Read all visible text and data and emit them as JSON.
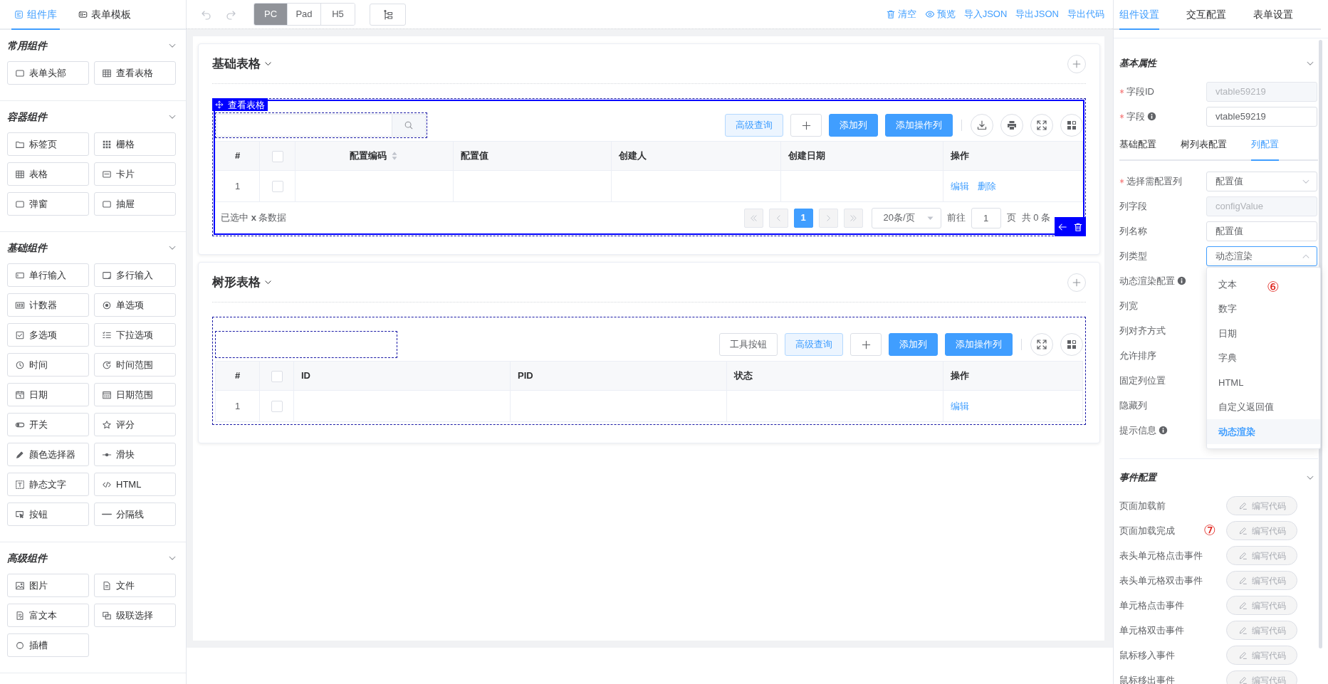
{
  "sidebar": {
    "tabs": [
      {
        "label": "组件库",
        "selected": true
      },
      {
        "label": "表单模板",
        "selected": false
      }
    ],
    "groups": [
      {
        "title": "常用组件",
        "expanded": true,
        "items": [
          "表单头部",
          "查看表格"
        ]
      },
      {
        "title": "容器组件",
        "expanded": true,
        "items": [
          "标签页",
          "栅格",
          "表格",
          "卡片",
          "弹窗",
          "抽屉"
        ]
      },
      {
        "title": "基础组件",
        "expanded": true,
        "items": [
          "单行输入",
          "多行输入",
          "计数器",
          "单选项",
          "多选项",
          "下拉选项",
          "时间",
          "时间范围",
          "日期",
          "日期范围",
          "开关",
          "评分",
          "颜色选择器",
          "滑块",
          "静态文字",
          "HTML",
          "按钮",
          "分隔线"
        ]
      },
      {
        "title": "高级组件",
        "expanded": true,
        "items": [
          "图片",
          "文件",
          "富文本",
          "级联选择",
          "插槽"
        ]
      }
    ]
  },
  "toolbar": {
    "devices": [
      {
        "label": "PC",
        "selected": true
      },
      {
        "label": "Pad",
        "selected": false
      },
      {
        "label": "H5",
        "selected": false
      }
    ],
    "actions": [
      "清空",
      "预览",
      "导入JSON",
      "导出JSON",
      "导出代码"
    ]
  },
  "canvas": {
    "panels": [
      {
        "title": "基础表格",
        "widget": {
          "tag": "查看表格",
          "selected": true,
          "search": {
            "kind": "button"
          },
          "buttons": [
            {
              "kind": "light",
              "label": "高级查询"
            },
            {
              "kind": "add"
            },
            {
              "kind": "primary",
              "label": "添加列"
            },
            {
              "kind": "primary",
              "label": "添加操作列"
            }
          ],
          "columns": [
            {
              "kind": "index",
              "label": "#"
            },
            {
              "kind": "checkbox",
              "checked": false
            },
            {
              "kind": "text",
              "label": "配置编码",
              "sortable": true
            },
            {
              "kind": "text",
              "label": "配置值",
              "sortable": false
            },
            {
              "kind": "text",
              "label": "创建人",
              "sortable": false
            },
            {
              "kind": "text",
              "label": "创建日期",
              "sortable": false
            },
            {
              "kind": "actions",
              "label": "操作"
            }
          ],
          "rows": [
            {
              "index": "1",
              "checked": false,
              "actions": [
                "编辑",
                "删除"
              ]
            }
          ],
          "footer": {
            "note": "已选中 **x** 条数据",
            "pages": [
              {
                "label": "1",
                "selected": true
              }
            ],
            "page_size": "20条/页",
            "goto_label": "前往",
            "goto_value": "1",
            "page_unit": "页",
            "total": "共 0 条"
          }
        }
      },
      {
        "title": "树形表格",
        "widget": {
          "selected": false,
          "search": {
            "kind": "plain"
          },
          "buttons": [
            {
              "kind": "outline",
              "label": "工具按钮"
            },
            {
              "kind": "light",
              "label": "高级查询"
            },
            {
              "kind": "add"
            },
            {
              "kind": "primary",
              "label": "添加列"
            },
            {
              "kind": "primary",
              "label": "添加操作列"
            }
          ],
          "columns": [
            {
              "kind": "index",
              "label": "#"
            },
            {
              "kind": "checkbox",
              "checked": false
            },
            {
              "kind": "text",
              "label": "ID",
              "sortable": false
            },
            {
              "kind": "text",
              "label": "PID",
              "sortable": false
            },
            {
              "kind": "text",
              "label": "状态",
              "sortable": false
            },
            {
              "kind": "actions",
              "label": "操作"
            }
          ],
          "rows": [
            {
              "index": "1",
              "checked": false,
              "actions": [
                "编辑"
              ]
            }
          ]
        }
      }
    ]
  },
  "properties": {
    "tabs": [
      {
        "label": "组件设置",
        "selected": true
      },
      {
        "label": "交互配置",
        "selected": false
      },
      {
        "label": "表单设置",
        "selected": false
      }
    ],
    "basic": {
      "title": "基本属性",
      "expanded": true,
      "fields": [
        {
          "label": "字段ID",
          "required": true,
          "info": false,
          "kind": "input",
          "value": "vtable59219",
          "disabled": true
        },
        {
          "label": "字段",
          "required": true,
          "info": true,
          "kind": "input",
          "value": "vtable59219",
          "disabled": false
        }
      ],
      "subtabs": [
        {
          "label": "基础配置",
          "selected": false
        },
        {
          "label": "树列表配置",
          "selected": false
        },
        {
          "label": "列配置",
          "selected": true
        }
      ],
      "column_fields": [
        {
          "label": "选择需配置列",
          "required": true,
          "info": false,
          "kind": "select",
          "value": "配置值",
          "expanded": false
        },
        {
          "label": "列字段",
          "required": false,
          "info": false,
          "kind": "input",
          "value": "configValue",
          "disabled": true
        },
        {
          "label": "列名称",
          "required": false,
          "info": false,
          "kind": "input",
          "value": "配置值",
          "disabled": false
        },
        {
          "label": "列类型",
          "required": false,
          "info": false,
          "kind": "select",
          "value": "动态渲染",
          "expanded": true,
          "options": [
            {
              "label": "文本",
              "selected": false
            },
            {
              "label": "数字",
              "selected": false
            },
            {
              "label": "日期",
              "selected": false
            },
            {
              "label": "字典",
              "selected": false
            },
            {
              "label": "HTML",
              "selected": false
            },
            {
              "label": "自定义返回值",
              "selected": false
            },
            {
              "label": "动态渲染",
              "selected": true
            }
          ]
        },
        {
          "label": "动态渲染配置",
          "required": false,
          "info": true,
          "kind": "label"
        },
        {
          "label": "列宽",
          "required": false,
          "info": false,
          "kind": "label"
        },
        {
          "label": "列对齐方式",
          "required": false,
          "info": false,
          "kind": "label"
        },
        {
          "label": "允许排序",
          "required": false,
          "info": false,
          "kind": "label"
        },
        {
          "label": "固定列位置",
          "required": false,
          "info": false,
          "kind": "label"
        },
        {
          "label": "隐藏列",
          "required": false,
          "info": false,
          "kind": "label"
        },
        {
          "label": "提示信息",
          "required": false,
          "info": true,
          "kind": "label"
        }
      ]
    },
    "events": {
      "title": "事件配置",
      "expanded": true,
      "items": [
        {
          "label": "页面加载前",
          "button": "编写代码"
        },
        {
          "label": "页面加载完成",
          "button": "编写代码"
        },
        {
          "label": "表头单元格点击事件",
          "button": "编写代码"
        },
        {
          "label": "表头单元格双击事件",
          "button": "编写代码"
        },
        {
          "label": "单元格点击事件",
          "button": "编写代码"
        },
        {
          "label": "单元格双击事件",
          "button": "编写代码"
        },
        {
          "label": "鼠标移入事件",
          "button": "编写代码"
        },
        {
          "label": "鼠标移出事件",
          "button": "编写代码"
        }
      ]
    }
  },
  "annotations": [
    "⑥",
    "⑦"
  ]
}
